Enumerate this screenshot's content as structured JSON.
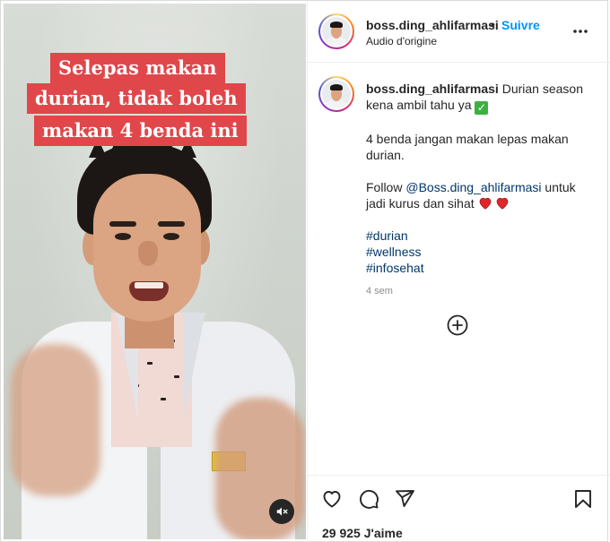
{
  "video": {
    "caption_lines": [
      "Selepas makan",
      "durian, tidak boleh",
      "makan 4 benda ini"
    ],
    "mute_icon": "speaker-muted-icon"
  },
  "header": {
    "username": "boss.ding_ahlifarmasi",
    "separator": "•",
    "follow_label": "Suivre",
    "audio_label": "Audio d'origine",
    "more_icon": "more-options-icon"
  },
  "post": {
    "username": "boss.ding_ahlifarmasi",
    "line1": "Durian season kena ambil tahu ya",
    "line2": "4 benda jangan makan lepas makan durian.",
    "follow_prefix": "Follow",
    "mention": "@Boss.ding_ahlifarmasi",
    "follow_suffix": "untuk jadi kurus dan sihat",
    "hashtags": [
      "#durian",
      "#wellness",
      "#infosehat"
    ],
    "time": "4 sem"
  },
  "actions": {
    "like_icon": "heart-icon",
    "comment_icon": "comment-icon",
    "share_icon": "share-icon",
    "save_icon": "bookmark-icon",
    "likes_text": "29 925 J'aime"
  },
  "colors": {
    "accent": "#0095f6",
    "caption_bg": "#e0474a",
    "link": "#00376b"
  }
}
